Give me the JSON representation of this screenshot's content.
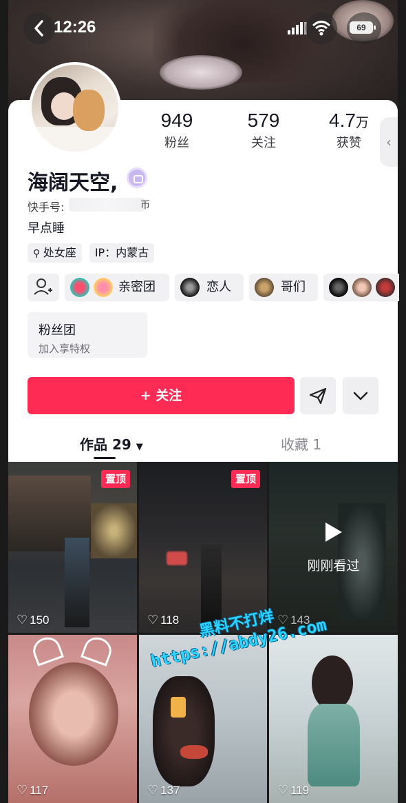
{
  "status_bar": {
    "time": "12:26",
    "battery": "69"
  },
  "profile": {
    "name": "海阔天空,",
    "account_label": "快手号:",
    "account_tail": "币",
    "bio": "早点睡",
    "stats": [
      {
        "value": "949",
        "unit": "",
        "label": "粉丝"
      },
      {
        "value": "579",
        "unit": "",
        "label": "关注"
      },
      {
        "value": "4.7",
        "unit": "万",
        "label": "获赞"
      }
    ],
    "tags": [
      "处女座",
      "IP：内蒙古"
    ],
    "circles": [
      {
        "label": "亲密团"
      },
      {
        "label": "恋人"
      },
      {
        "label": "哥们"
      }
    ],
    "fan_club": {
      "title": "粉丝团",
      "subtitle": "加入享特权"
    },
    "follow_label": "+ 关注"
  },
  "tabs": {
    "works_label": "作品 29",
    "favorites_label": "收藏 1"
  },
  "videos": [
    {
      "likes": "150",
      "pinned": true,
      "pin_label": "置顶"
    },
    {
      "likes": "118",
      "pinned": true,
      "pin_label": "置顶"
    },
    {
      "likes": "143",
      "pinned": false,
      "overlay_label": "刚刚看过"
    },
    {
      "likes": "117",
      "pinned": false
    },
    {
      "likes": "137",
      "pinned": false
    },
    {
      "likes": "119",
      "pinned": false
    }
  ],
  "watermark": {
    "line1": "黑料不打烊",
    "line2": "https://abdy26.com"
  },
  "colors": {
    "accent": "#fe2c55",
    "card_bg": "#ffffff",
    "chip_bg": "#f1f1f3",
    "watermark": "#2cd4ff"
  },
  "icons": {
    "back": "chevron-left-icon",
    "signal": "signal-icon",
    "wifi": "wifi-icon",
    "battery": "battery-icon",
    "add_friend": "add-friend-icon",
    "share": "send-icon",
    "more": "chevron-down-icon",
    "location": "pin-icon",
    "heart": "heart-icon",
    "play": "play-icon",
    "badge": "camera-badge-icon"
  }
}
